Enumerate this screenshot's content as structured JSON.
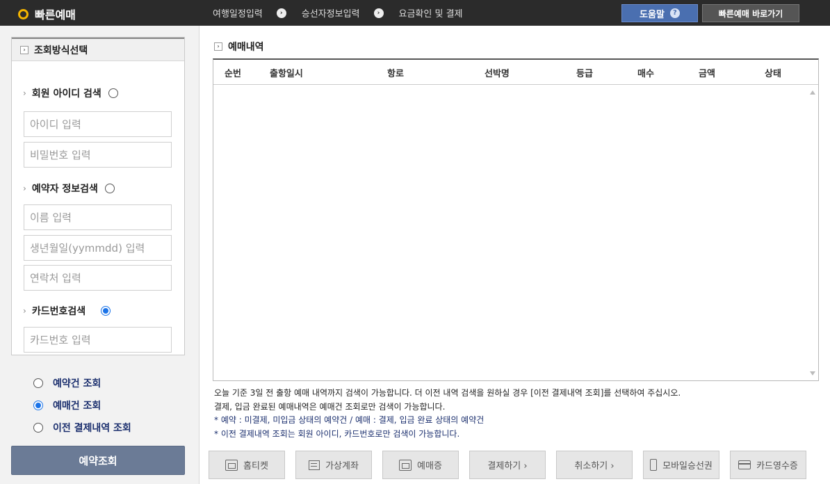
{
  "header": {
    "brand": "빠른예매",
    "steps": [
      "여행일정입력",
      "승선자정보입력",
      "요금확인 및 결제"
    ],
    "help_label": "도움말",
    "help_glyph": "?",
    "quick_label": "빠른예매 바로가기",
    "brand_color": "#f3b400"
  },
  "left": {
    "box_title": "조회방식선택",
    "sections": [
      {
        "label": "회원 아이디 검색",
        "selected": false,
        "fields": [
          "아이디 입력",
          "비밀번호 입력"
        ]
      },
      {
        "label": "예약자 정보검색",
        "selected": false,
        "fields": [
          "이름 입력",
          "생년월일(yymmdd) 입력",
          "연락처 입력"
        ]
      },
      {
        "label": "카드번호검색",
        "selected": true,
        "fields": [
          "카드번호 입력"
        ]
      }
    ],
    "options": [
      {
        "label": "예약건 조회",
        "selected": false
      },
      {
        "label": "예매건 조회",
        "selected": true
      },
      {
        "label": "이전 결제내역 조회",
        "selected": false
      }
    ],
    "reserve_button": "예약조회"
  },
  "main": {
    "title": "예매내역",
    "columns": [
      "순번",
      "출항일시",
      "항로",
      "선박명",
      "등급",
      "매수",
      "금액",
      "상태"
    ],
    "notes": [
      "오늘 기준 3일 전 출항 예매 내역까지 검색이 가능합니다. 더 이전 내역 검색을 원하실 경우 [이전 결제내역 조회]를 선택하여 주십시오.",
      "결제, 입금 완료된 예매내역은 예매건 조회로만 검색이 가능합니다.",
      "* 예약 : 미결제, 미입금 상태의 예약건 / 예매 : 결제, 입금 완료 상태의 예약건",
      "* 이전 결제내역 조회는 회원 아이디, 카드번호로만 검색이 가능합니다."
    ],
    "buttons": [
      {
        "label": "홈티켓",
        "icon": "printer-icon"
      },
      {
        "label": "가상계좌",
        "icon": "account-icon"
      },
      {
        "label": "예매증",
        "icon": "printer-icon"
      },
      {
        "label": "결제하기 ›",
        "icon": ""
      },
      {
        "label": "취소하기 ›",
        "icon": ""
      },
      {
        "label": "모바일승선권",
        "icon": "phone-icon"
      },
      {
        "label": "카드영수증",
        "icon": "card-icon"
      }
    ]
  }
}
